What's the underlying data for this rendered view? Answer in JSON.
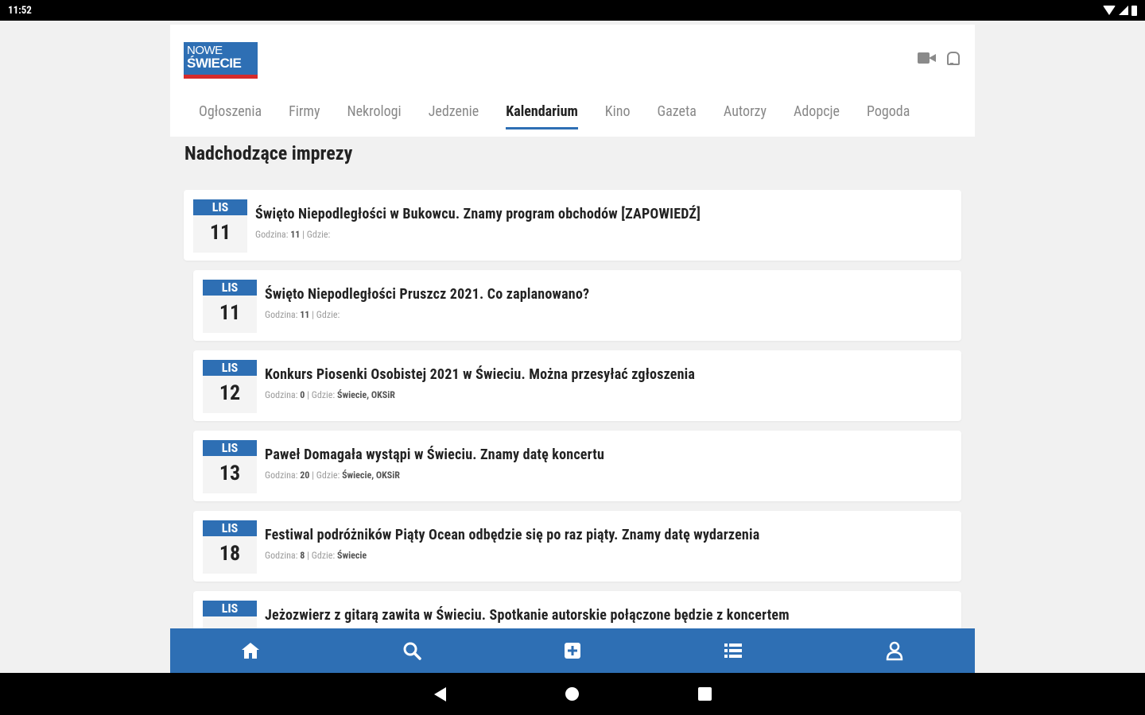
{
  "status_bar": {
    "time": "11:52"
  },
  "logo": {
    "line1": "NOWE",
    "line2": "ŚWIECIE"
  },
  "nav": {
    "items": [
      {
        "label": "Ogłoszenia"
      },
      {
        "label": "Firmy"
      },
      {
        "label": "Nekrologi"
      },
      {
        "label": "Jedzenie"
      },
      {
        "label": "Kalendarium",
        "active": true
      },
      {
        "label": "Kino"
      },
      {
        "label": "Gazeta"
      },
      {
        "label": "Autorzy"
      },
      {
        "label": "Adopcje"
      },
      {
        "label": "Pogoda"
      }
    ]
  },
  "page": {
    "title": "Nadchodzące imprezy"
  },
  "events": [
    {
      "month": "LIS",
      "day": "11",
      "title": "Święto Niepodległości w Bukowcu. Znamy program obchodów [ZAPOWIEDŹ]",
      "meta_hour_label": "Godzina:",
      "meta_hour": "11",
      "meta_place_label": "| Gdzie:",
      "meta_place": ""
    },
    {
      "month": "LIS",
      "day": "11",
      "title": "Święto Niepodległości Pruszcz 2021. Co zaplanowano?",
      "meta_hour_label": "Godzina:",
      "meta_hour": "11",
      "meta_place_label": "| Gdzie:",
      "meta_place": ""
    },
    {
      "month": "LIS",
      "day": "12",
      "title": "Konkurs Piosenki Osobistej 2021 w Świeciu. Można przesyłać zgłoszenia",
      "meta_hour_label": "Godzina:",
      "meta_hour": "0",
      "meta_place_label": "| Gdzie:",
      "meta_place": "Świecie, OKSiR"
    },
    {
      "month": "LIS",
      "day": "13",
      "title": "Paweł Domagała wystąpi w Świeciu. Znamy datę koncertu",
      "meta_hour_label": "Godzina:",
      "meta_hour": "20",
      "meta_place_label": "| Gdzie:",
      "meta_place": "Świecie, OKSiR"
    },
    {
      "month": "LIS",
      "day": "18",
      "title": "Festiwal podróżników Piąty Ocean odbędzie się po raz piąty. Znamy datę wydarzenia",
      "meta_hour_label": "Godzina:",
      "meta_hour": "8",
      "meta_place_label": "| Gdzie:",
      "meta_place": "Świecie"
    },
    {
      "month": "LIS",
      "day": "",
      "title": "Jeżozwierz z gitarą zawita w Świeciu. Spotkanie autorskie połączone będzie z koncertem",
      "meta_hour_label": "",
      "meta_hour": "",
      "meta_place_label": "",
      "meta_place": ""
    }
  ],
  "bottom_nav": [
    {
      "icon": "home-icon"
    },
    {
      "icon": "search-icon"
    },
    {
      "icon": "add-box-icon"
    },
    {
      "icon": "list-icon"
    },
    {
      "icon": "user-icon"
    }
  ],
  "colors": {
    "accent": "#2e6fb4",
    "logo_stripe": "#d62b2b"
  }
}
